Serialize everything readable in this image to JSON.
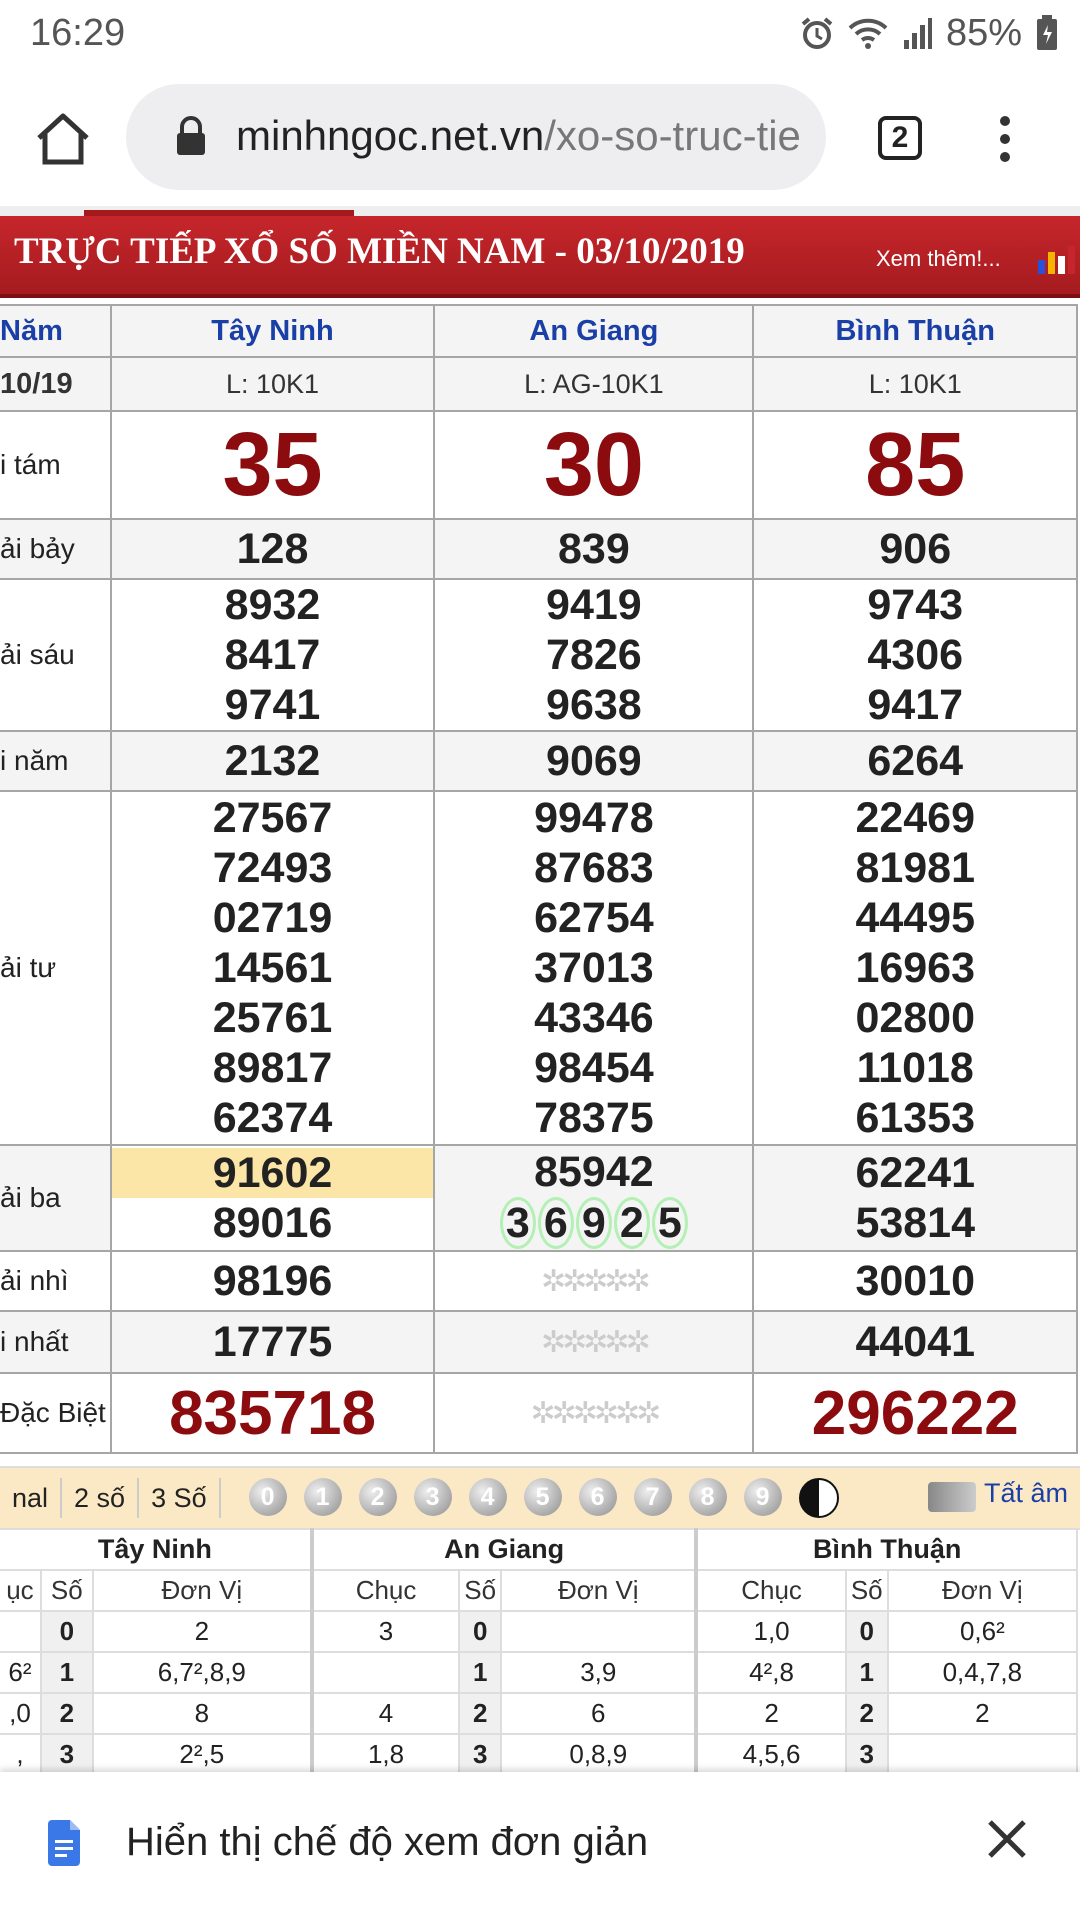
{
  "status_bar": {
    "time": "16:29",
    "battery": "85%"
  },
  "browser": {
    "url_host": "minhngoc.net.vn",
    "url_path": "/xo-so-truc-tie",
    "tab_count": "2"
  },
  "banner": {
    "title": "TRỰC TIẾP XỔ SỐ MIỀN NAM - 03/10/2019",
    "more": "Xem thêm!..."
  },
  "results": {
    "day_label": "Năm",
    "date_label": "10/19",
    "provinces": [
      {
        "name": "Tây Ninh",
        "lot": "L: 10K1"
      },
      {
        "name": "An Giang",
        "lot": "L: AG-10K1"
      },
      {
        "name": "Bình Thuận",
        "lot": "L: 10K1"
      }
    ],
    "prize_labels": {
      "g8": "i tám",
      "g7": "ải bảy",
      "g6": "ải sáu",
      "g5": "i năm",
      "g4": "ải tư",
      "g3": "ải ba",
      "g2": "ải nhì",
      "g1": "i nhất",
      "db": "Đặc Biệt"
    },
    "g8": [
      "35",
      "30",
      "85"
    ],
    "g7": [
      "128",
      "839",
      "906"
    ],
    "g6": [
      [
        "8932",
        "8417",
        "9741"
      ],
      [
        "9419",
        "7826",
        "9638"
      ],
      [
        "9743",
        "4306",
        "9417"
      ]
    ],
    "g5": [
      "2132",
      "9069",
      "6264"
    ],
    "g4": [
      [
        "27567",
        "72493",
        "02719",
        "14561",
        "25761",
        "89817",
        "62374"
      ],
      [
        "99478",
        "87683",
        "62754",
        "37013",
        "43346",
        "98454",
        "78375"
      ],
      [
        "22469",
        "81981",
        "44495",
        "16963",
        "02800",
        "11018",
        "61353"
      ]
    ],
    "g3": [
      [
        "91602",
        "89016"
      ],
      [
        "85942",
        "36925"
      ],
      [
        "62241",
        "53814"
      ]
    ],
    "g2": [
      "98196",
      "",
      "30010"
    ],
    "g1": [
      "17775",
      "",
      "44041"
    ],
    "db": [
      "835718",
      "",
      "296222"
    ]
  },
  "filter_bar": {
    "options": [
      "nal",
      "2 số",
      "3 Số"
    ],
    "digits": [
      "0",
      "1",
      "2",
      "3",
      "4",
      "5",
      "6",
      "7",
      "8",
      "9"
    ],
    "all_label": "Tất âm"
  },
  "stats": {
    "provinces": [
      "Tây Ninh",
      "An Giang",
      "Bình Thuận"
    ],
    "headers": [
      "ục",
      "Số",
      "Đơn Vị",
      "Chục",
      "Số",
      "Đơn Vị",
      "Chục",
      "Số",
      "Đơn Vị"
    ],
    "rows": [
      [
        "",
        "0",
        "2",
        "3",
        "0",
        "",
        "1,0",
        "0",
        "0,6²"
      ],
      [
        "6²",
        "1",
        "6,7²,8,9",
        "",
        "1",
        "3,9",
        "4²,8",
        "1",
        "0,4,7,8"
      ],
      [
        ",0",
        "2",
        "8",
        "4",
        "2",
        "6",
        "2",
        "2",
        "2"
      ],
      [
        ",",
        "3",
        "2²,5",
        "1,8",
        "3",
        "0,8,9",
        "4,5,6",
        "3",
        ""
      ]
    ]
  },
  "simple_view": {
    "label": "Hiển thị chế độ xem đơn giản"
  }
}
